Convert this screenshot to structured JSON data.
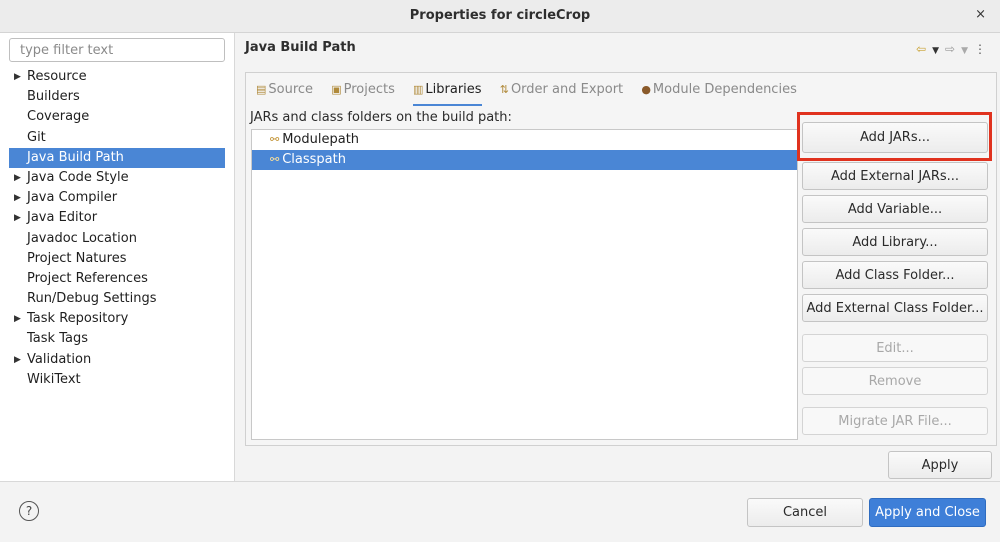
{
  "window": {
    "title": "Properties for circleCrop",
    "close_icon": "×"
  },
  "sidebar": {
    "filter_placeholder": "type filter text",
    "items": [
      {
        "label": "Resource",
        "expandable": true
      },
      {
        "label": "Builders",
        "expandable": false
      },
      {
        "label": "Coverage",
        "expandable": false
      },
      {
        "label": "Git",
        "expandable": false
      },
      {
        "label": "Java Build Path",
        "expandable": false,
        "selected": true
      },
      {
        "label": "Java Code Style",
        "expandable": true
      },
      {
        "label": "Java Compiler",
        "expandable": true
      },
      {
        "label": "Java Editor",
        "expandable": true
      },
      {
        "label": "Javadoc Location",
        "expandable": false
      },
      {
        "label": "Project Natures",
        "expandable": false
      },
      {
        "label": "Project References",
        "expandable": false
      },
      {
        "label": "Run/Debug Settings",
        "expandable": false
      },
      {
        "label": "Task Repository",
        "expandable": true
      },
      {
        "label": "Task Tags",
        "expandable": false
      },
      {
        "label": "Validation",
        "expandable": true
      },
      {
        "label": "WikiText",
        "expandable": false
      }
    ]
  },
  "main": {
    "title": "Java Build Path",
    "tabs": [
      {
        "label": "Source",
        "icon": "source-folder-icon"
      },
      {
        "label": "Projects",
        "icon": "projects-icon"
      },
      {
        "label": "Libraries",
        "icon": "libraries-icon",
        "active": true
      },
      {
        "label": "Order and Export",
        "icon": "order-export-icon"
      },
      {
        "label": "Module Dependencies",
        "icon": "module-icon"
      }
    ],
    "list_label": "JARs and class folders on the build path:",
    "entries": [
      {
        "label": "Modulepath",
        "selected": false
      },
      {
        "label": "Classpath",
        "selected": true
      }
    ],
    "buttons": {
      "add_jars": "Add JARs...",
      "add_external_jars": "Add External JARs...",
      "add_variable": "Add Variable...",
      "add_library": "Add Library...",
      "add_class_folder": "Add Class Folder...",
      "add_external_class_folder": "Add External Class Folder...",
      "edit": "Edit...",
      "remove": "Remove",
      "migrate_jar": "Migrate JAR File..."
    },
    "apply": "Apply"
  },
  "footer": {
    "help": "?",
    "cancel": "Cancel",
    "apply_and_close": "Apply and Close"
  },
  "colors": {
    "selection": "#4a86d5",
    "highlight": "#e0321e",
    "primary_button": "#3e7fd8"
  }
}
